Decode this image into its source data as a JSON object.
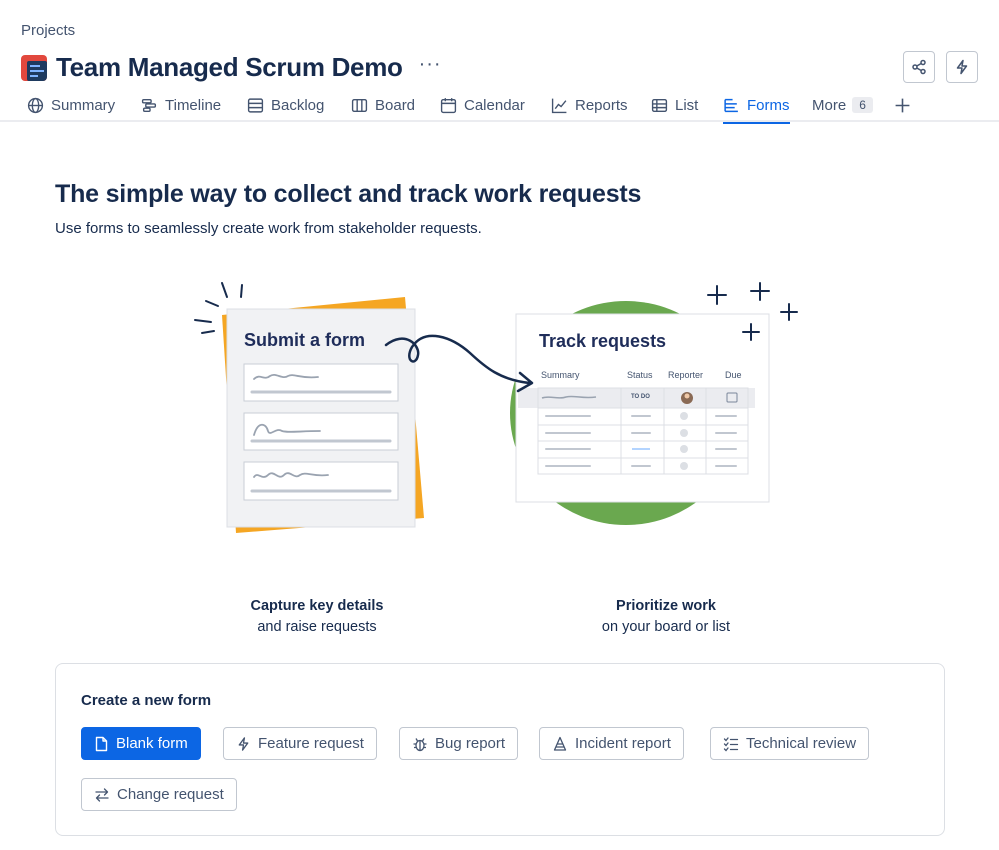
{
  "breadcrumb": "Projects",
  "project": {
    "title": "Team Managed Scrum Demo",
    "more_label": "···",
    "icon": "project-board-icon"
  },
  "header_actions": [
    {
      "icon": "share-icon"
    },
    {
      "icon": "lightning-icon"
    }
  ],
  "tabs": [
    {
      "label": "Summary",
      "icon": "globe-icon"
    },
    {
      "label": "Timeline",
      "icon": "timeline-icon"
    },
    {
      "label": "Backlog",
      "icon": "backlog-icon"
    },
    {
      "label": "Board",
      "icon": "board-icon"
    },
    {
      "label": "Calendar",
      "icon": "calendar-icon"
    },
    {
      "label": "Reports",
      "icon": "chart-icon"
    },
    {
      "label": "List",
      "icon": "list-icon"
    },
    {
      "label": "Forms",
      "icon": "forms-icon",
      "active": true
    },
    {
      "label": "More",
      "count": "6"
    },
    {
      "label": "+",
      "icon": "plus-icon"
    }
  ],
  "hero": {
    "title": "The simple way to collect and track work requests",
    "subtitle": "Use forms to seamlessly create work from stakeholder requests."
  },
  "illustration": {
    "form_card_title": "Submit a form",
    "track_card_title": "Track requests",
    "table_headers": [
      "Summary",
      "Status",
      "Reporter",
      "Due"
    ],
    "status_chip": "TO DO"
  },
  "captions": [
    {
      "bold": "Capture key details",
      "text": "and raise requests"
    },
    {
      "bold": "Prioritize work",
      "text": "on your board or list"
    }
  ],
  "create_form": {
    "title": "Create a new form",
    "buttons": [
      {
        "label": "Blank form",
        "icon": "page-icon",
        "primary": true
      },
      {
        "label": "Feature request",
        "icon": "lightning-icon"
      },
      {
        "label": "Bug report",
        "icon": "bug-icon"
      },
      {
        "label": "Incident report",
        "icon": "warning-cone-icon"
      },
      {
        "label": "Technical review",
        "icon": "checklist-icon"
      },
      {
        "label": "Change request",
        "icon": "swap-arrows-icon"
      }
    ]
  },
  "colors": {
    "accent": "#0c66e4",
    "text": "#172b4d",
    "subtle": "#44546f",
    "illus_yellow": "#f5a623",
    "illus_green": "#6aa84f"
  }
}
